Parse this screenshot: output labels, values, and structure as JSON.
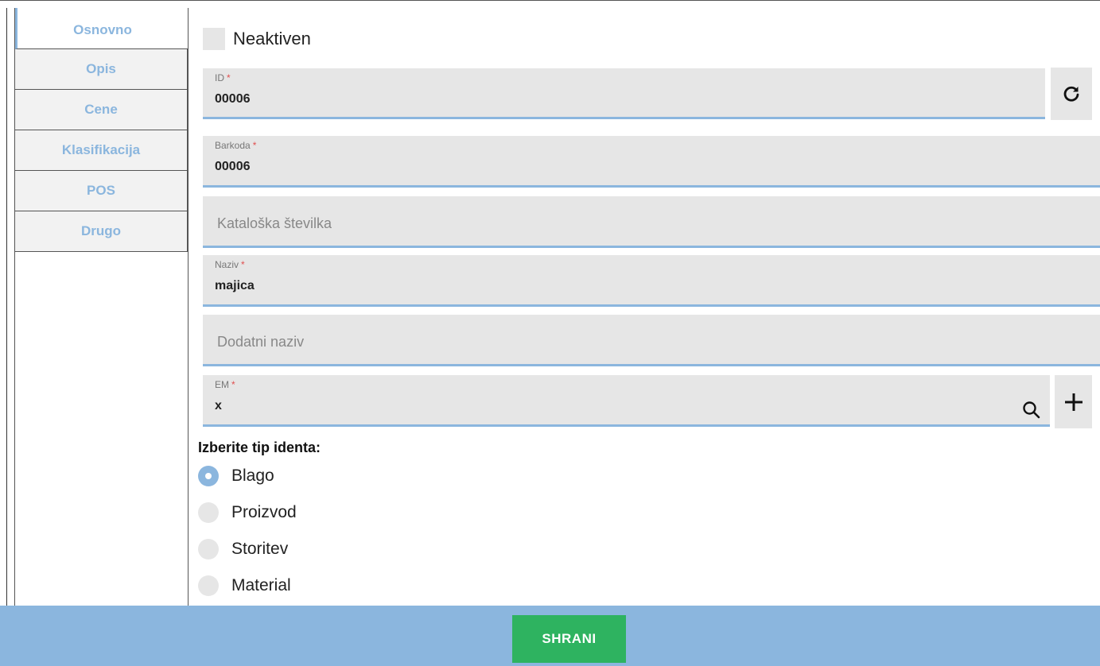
{
  "sidebar": {
    "tabs": [
      {
        "label": "Osnovno",
        "active": true
      },
      {
        "label": "Opis"
      },
      {
        "label": "Cene"
      },
      {
        "label": "Klasifikacija"
      },
      {
        "label": "POS"
      },
      {
        "label": "Drugo"
      }
    ]
  },
  "form": {
    "inactive_label": "Neaktiven",
    "required_mark": "*",
    "id": {
      "label": "ID",
      "value": "00006"
    },
    "barcode": {
      "label": "Barkoda",
      "value": "00006"
    },
    "catalog_number": {
      "placeholder": "Kataloška številka"
    },
    "name": {
      "label": "Naziv",
      "value": "majica"
    },
    "additional_name": {
      "placeholder": "Dodatni naziv"
    },
    "unit": {
      "label": "EM",
      "value": "x"
    },
    "ident_type": {
      "title": "Izberite tip identa:",
      "options": [
        "Blago",
        "Proizvod",
        "Storitev",
        "Material"
      ],
      "selected": "Blago"
    }
  },
  "footer": {
    "save_label": "SHRANI"
  },
  "colors": {
    "accent": "#8bb6de",
    "save": "#2eb360",
    "field_bg": "#e6e6e6"
  },
  "icons": {
    "refresh": "refresh-icon",
    "search": "search-icon",
    "add": "plus-icon"
  }
}
